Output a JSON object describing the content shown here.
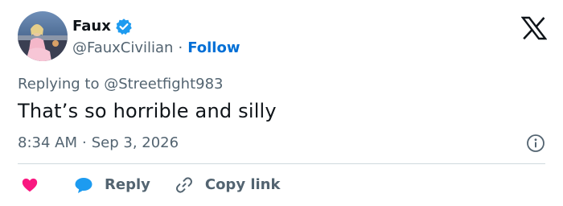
{
  "author": {
    "display_name": "Faux",
    "handle": "@FauxCivilian",
    "follow_label": "Follow",
    "verified": true,
    "avatar_icon": "avatar-photo"
  },
  "tweet": {
    "replying_to": "Replying to @Streetfight983",
    "text": "That’s so horrible and silly",
    "time": "8:34 AM",
    "date": "Sep 3, 2026"
  },
  "separator": "·",
  "actions": {
    "like_icon": "heart-icon",
    "reply_label": "Reply",
    "copy_link_label": "Copy link"
  },
  "icons": {
    "brand": "x-logo-icon",
    "verified": "verified-badge-icon",
    "info": "info-icon",
    "reply": "reply-bubble-icon",
    "link": "link-icon"
  },
  "colors": {
    "text_primary": "#0f1419",
    "text_secondary": "#536471",
    "link_blue": "#006fd6",
    "verified_blue": "#1d9bf0",
    "like_pink": "#f91880",
    "divider": "#cfd9de"
  }
}
